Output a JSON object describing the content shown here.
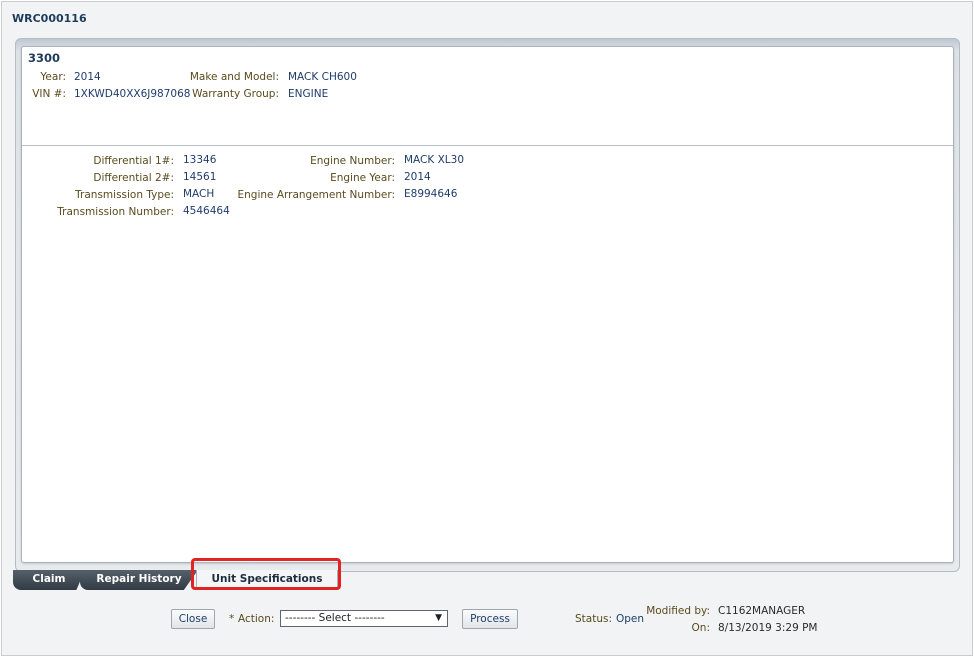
{
  "header": {
    "claim_id": "WRC000116"
  },
  "unit": {
    "number": "3300",
    "year_label": "Year:",
    "year_value": "2014",
    "vin_label": "VIN #:",
    "vin_value": "1XKWD40XX6J987068",
    "make_model_label": "Make and Model:",
    "make_model_value": "MACK CH600",
    "warranty_group_label": "Warranty Group:",
    "warranty_group_value": "ENGINE"
  },
  "specs": {
    "diff1_label": "Differential 1#:",
    "diff1_value": "13346",
    "diff2_label": "Differential 2#:",
    "diff2_value": "14561",
    "trans_type_label": "Transmission Type:",
    "trans_type_value": "MACH",
    "trans_num_label": "Transmission Number:",
    "trans_num_value": "4546464",
    "engine_num_label": "Engine Number:",
    "engine_num_value": "MACK XL30",
    "engine_year_label": "Engine Year:",
    "engine_year_value": "2014",
    "engine_arr_label": "Engine Arrangement Number:",
    "engine_arr_value": "E8994646"
  },
  "tabs": [
    {
      "label": "Claim"
    },
    {
      "label": "Repair History"
    },
    {
      "label": "Unit Specifications"
    }
  ],
  "footer": {
    "close_label": "Close",
    "action_required_mark": "*",
    "action_label": "Action:",
    "action_selected": "-------- Select --------",
    "process_label": "Process",
    "status_label": "Status:",
    "status_value": "Open",
    "modified_by_label": "Modified by:",
    "modified_by_value": "C1162MANAGER",
    "on_label": "On:",
    "on_value": "8/13/2019 3:29 PM"
  },
  "colors": {
    "highlight": "#e02424",
    "tab_dark": "#3a444e",
    "label": "#5a4a1e",
    "value": "#1f3d6b"
  }
}
